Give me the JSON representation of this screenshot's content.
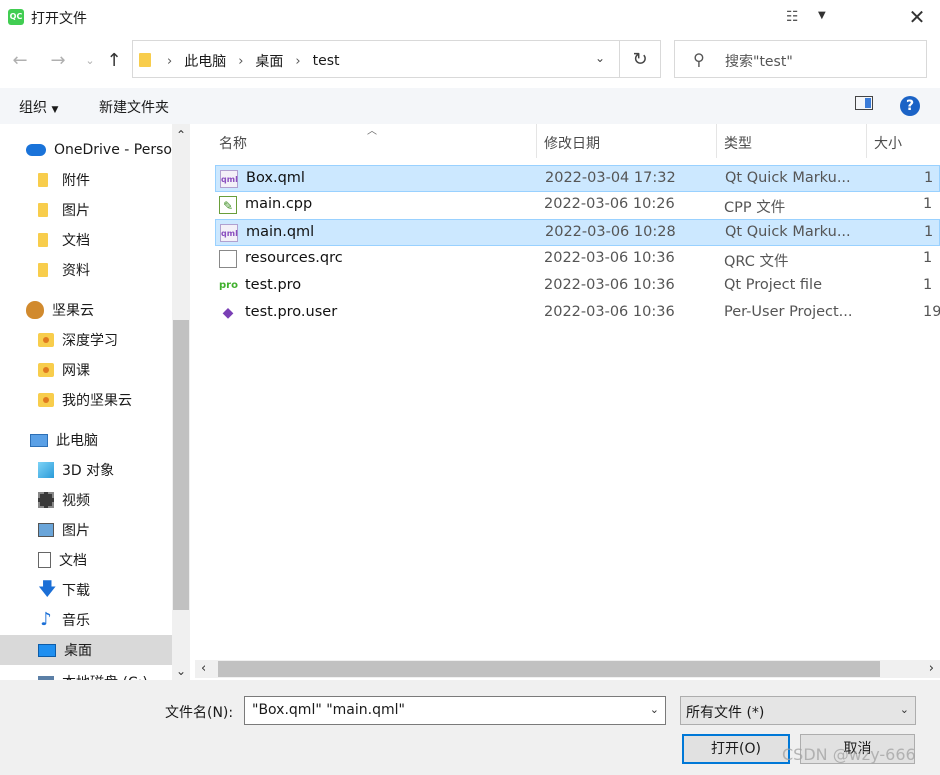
{
  "window": {
    "title": "打开文件",
    "app_icon_text": "QC"
  },
  "address": {
    "crumbs": [
      "此电脑",
      "桌面",
      "test"
    ],
    "search_placeholder": "搜索\"test\""
  },
  "toolbar": {
    "organize": "组织",
    "new_folder": "新建文件夹"
  },
  "sidebar": {
    "items": [
      {
        "label": "OneDrive - Perso",
        "icon": "cloud-icon"
      },
      {
        "label": "附件",
        "icon": "folder-icon"
      },
      {
        "label": "图片",
        "icon": "folder-icon"
      },
      {
        "label": "文档",
        "icon": "folder-icon"
      },
      {
        "label": "资料",
        "icon": "folder-icon"
      },
      {
        "label": "坚果云",
        "icon": "acorn-icon"
      },
      {
        "label": "深度学习",
        "icon": "sync-folder-icon"
      },
      {
        "label": "网课",
        "icon": "sync-folder-icon"
      },
      {
        "label": "我的坚果云",
        "icon": "sync-folder-icon"
      },
      {
        "label": "此电脑",
        "icon": "computer-icon"
      },
      {
        "label": "3D 对象",
        "icon": "cube-icon"
      },
      {
        "label": "视频",
        "icon": "film-icon"
      },
      {
        "label": "图片",
        "icon": "picture-icon"
      },
      {
        "label": "文档",
        "icon": "document-icon"
      },
      {
        "label": "下载",
        "icon": "download-icon"
      },
      {
        "label": "音乐",
        "icon": "music-icon"
      },
      {
        "label": "桌面",
        "icon": "desktop-icon"
      },
      {
        "label": "本地磁盘 (C:)",
        "icon": "drive-icon"
      }
    ]
  },
  "columns": {
    "name": "名称",
    "date": "修改日期",
    "type": "类型",
    "size": "大小"
  },
  "files": [
    {
      "name": "Box.qml",
      "date": "2022-03-04 17:32",
      "type": "Qt Quick Marku...",
      "size": "1",
      "icon": "qml"
    },
    {
      "name": "main.cpp",
      "date": "2022-03-06 10:26",
      "type": "CPP 文件",
      "size": "1",
      "icon": "cpp"
    },
    {
      "name": "main.qml",
      "date": "2022-03-06 10:28",
      "type": "Qt Quick Marku...",
      "size": "1",
      "icon": "qml"
    },
    {
      "name": "resources.qrc",
      "date": "2022-03-06 10:36",
      "type": "QRC 文件",
      "size": "1",
      "icon": "qrc"
    },
    {
      "name": "test.pro",
      "date": "2022-03-06 10:36",
      "type": "Qt Project file",
      "size": "1",
      "icon": "pro"
    },
    {
      "name": "test.pro.user",
      "date": "2022-03-06 10:36",
      "type": "Per-User Project...",
      "size": "19",
      "icon": "user"
    }
  ],
  "bottom": {
    "filename_label": "文件名(N):",
    "filename_value": "\"Box.qml\" \"main.qml\"",
    "filter_value": "所有文件 (*)",
    "open_label": "打开(O)",
    "cancel_label": "取消",
    "watermark": "CSDN @wzy-666"
  },
  "icons": {
    "qml": "qml",
    "pro": "pro"
  }
}
